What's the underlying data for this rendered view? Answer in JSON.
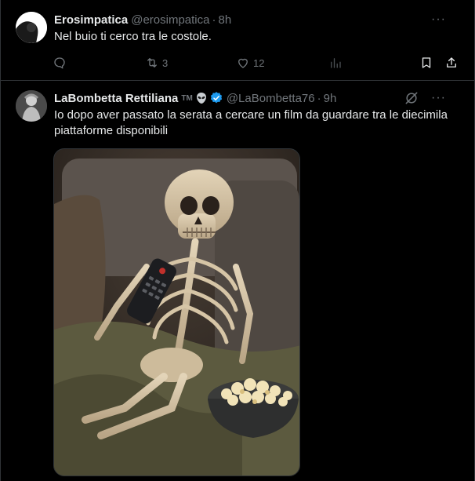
{
  "tweets": [
    {
      "name": "Erosimpatica",
      "handle": "@erosimpatica",
      "time": "8h",
      "text": "Nel buio ti cerco tra le costole.",
      "actions": {
        "replies": "",
        "retweets": "3",
        "likes": "12"
      }
    },
    {
      "name": "LaBombetta Rettiliana",
      "badge_text": "TM",
      "handle": "@LaBombetta76",
      "time": "9h",
      "text": "Io dopo aver passato la serata a cercare un film da guardare tra le diecimila piattaforme disponibili"
    }
  ],
  "separator": "·",
  "more_label": "···",
  "icons": [
    "reply-icon",
    "retweet-icon",
    "like-icon",
    "views-icon",
    "bookmark-icon",
    "share-icon",
    "more-icon",
    "alien-icon",
    "verified-icon",
    "grok-icon"
  ],
  "colors": {
    "background": "#000000",
    "text": "#e7e9ea",
    "muted": "#71767b",
    "border": "#2f3336",
    "verified": "#1d9bf0"
  }
}
